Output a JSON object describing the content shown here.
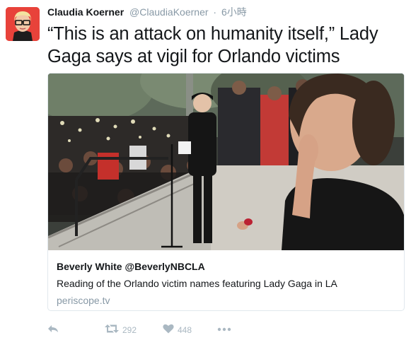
{
  "tweet": {
    "author_name": "Claudia Koerner",
    "author_handle": "@ClaudiaKoerner",
    "separator": "·",
    "timestamp": "6小時",
    "text": "“This is an attack on humanity itself,” Lady Gaga says at vigil for Orlando victims"
  },
  "card": {
    "title": "Beverly White @BeverlyNBCLA",
    "description": "Reading of the Orlando victim names featuring Lady Gaga in LA",
    "domain": "periscope.tv"
  },
  "actions": {
    "reply_icon": "reply-icon",
    "retweet_icon": "retweet-icon",
    "retweet_count": "292",
    "like_icon": "heart-icon",
    "like_count": "448",
    "more_icon": "more-dots-icon"
  },
  "colors": {
    "text": "#14171a",
    "muted": "#8899a6",
    "action": "#aab8c2",
    "border": "#e1e8ed",
    "avatar_bg": "#e8423a"
  }
}
